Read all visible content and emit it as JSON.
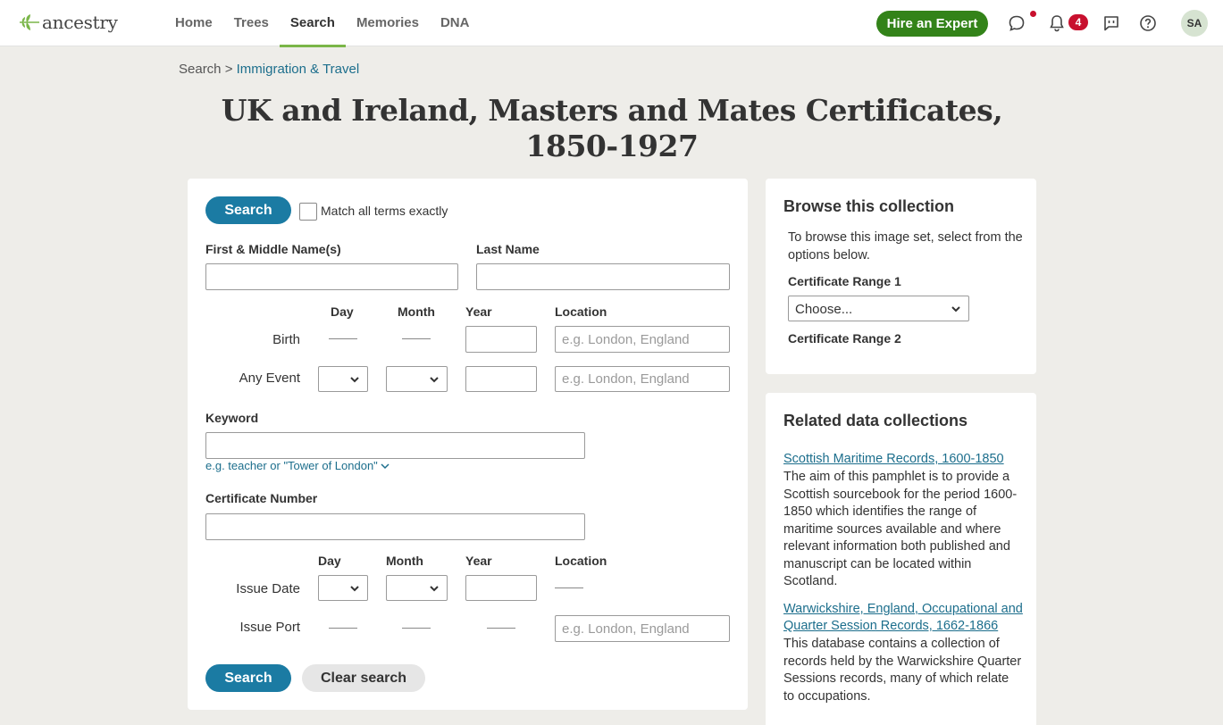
{
  "header": {
    "logo_text": "ancestry",
    "nav": [
      {
        "label": "Home"
      },
      {
        "label": "Trees"
      },
      {
        "label": "Search"
      },
      {
        "label": "Memories"
      },
      {
        "label": "DNA"
      }
    ],
    "active_nav": "Search",
    "hire_button": "Hire an Expert",
    "notification_count": "4",
    "avatar_initials": "SA",
    "brand_green": "#338319",
    "accent_blue": "#1b7ba3"
  },
  "breadcrumb": {
    "root": "Search",
    "separator": ">",
    "current": "Immigration & Travel"
  },
  "title": "UK and Ireland, Masters and Mates Certificates, 1850-1927",
  "form": {
    "search_button": "Search",
    "match_exact_label": "Match all terms exactly",
    "first_name_label": "First & Middle Name(s)",
    "last_name_label": "Last Name",
    "first_name_value": "",
    "last_name_value": "",
    "col_day": "Day",
    "col_month": "Month",
    "col_year": "Year",
    "col_location": "Location",
    "row_birth": "Birth",
    "row_any_event": "Any Event",
    "location_placeholder": "e.g. London, England",
    "keyword_label": "Keyword",
    "keyword_hint": "e.g. teacher or \"Tower of London\"",
    "certificate_label": "Certificate Number",
    "row_issue_date": "Issue Date",
    "row_issue_port": "Issue Port",
    "bottom_search_button": "Search",
    "clear_button": "Clear search"
  },
  "browse": {
    "title": "Browse this collection",
    "description": "To browse this image set, select from the options below.",
    "range1_label": "Certificate Range 1",
    "range1_value": "Choose...",
    "range2_label": "Certificate Range 2"
  },
  "related": {
    "title": "Related data collections",
    "items": [
      {
        "link": "Scottish Maritime Records, 1600-1850",
        "description": "The aim of this pamphlet is to provide a Scottish sourcebook for the period 1600-1850 which identifies the range of maritime sources available and where relevant information both published and manuscript can be located within Scotland."
      },
      {
        "link": "Warwickshire, England, Occupational and Quarter Session Records, 1662-1866",
        "description": "This database contains a collection of records held by the Warwickshire Quarter Sessions records, many of which relate to occupations."
      }
    ]
  }
}
